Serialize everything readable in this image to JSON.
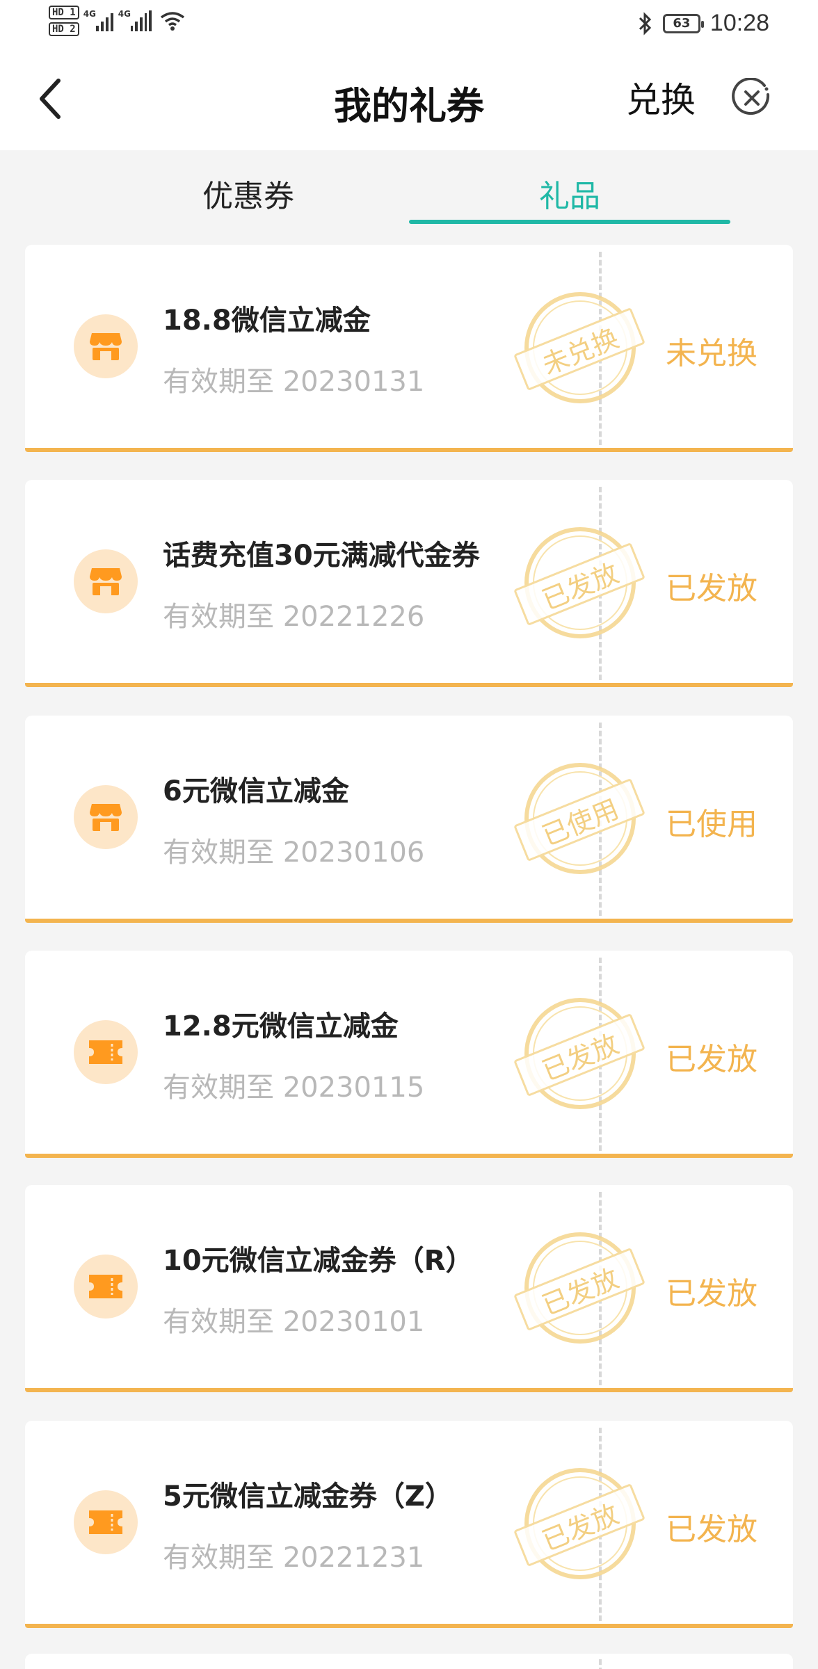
{
  "status_bar": {
    "sim1": "HD 1",
    "sim2": "HD 2",
    "net1": "4G",
    "net2": "4G",
    "battery": "63",
    "time": "10:28"
  },
  "header": {
    "title": "我的礼券",
    "redeem_label": "兑换",
    "back_icon": "chevron-left-icon",
    "close_icon": "close-circle-icon"
  },
  "tabs": [
    {
      "label": "优惠券",
      "active": false
    },
    {
      "label": "礼品",
      "active": true
    }
  ],
  "colors": {
    "accent": "#1fb8a6",
    "status_orange": "#f3b44f",
    "stamp": "#f5d58c",
    "expiry_gray": "#b8b8b8"
  },
  "cards": [
    {
      "icon": "shop-icon",
      "name": "18.8微信立减金",
      "expiry": "有效期至 20230131",
      "stamp": "未兑换",
      "status": "未兑换"
    },
    {
      "icon": "shop-icon",
      "name": "话费充值30元满减代金券",
      "expiry": "有效期至 20221226",
      "stamp": "已发放",
      "status": "已发放"
    },
    {
      "icon": "shop-icon",
      "name": "6元微信立减金",
      "expiry": "有效期至 20230106",
      "stamp": "已使用",
      "status": "已使用"
    },
    {
      "icon": "ticket-icon",
      "name": "12.8元微信立减金",
      "expiry": "有效期至 20230115",
      "stamp": "已发放",
      "status": "已发放"
    },
    {
      "icon": "ticket-icon",
      "name": "10元微信立减金券（R）",
      "expiry": "有效期至 20230101",
      "stamp": "已发放",
      "status": "已发放"
    },
    {
      "icon": "ticket-icon",
      "name": "5元微信立减金券（Z）",
      "expiry": "有效期至 20221231",
      "stamp": "已发放",
      "status": "已发放"
    }
  ]
}
